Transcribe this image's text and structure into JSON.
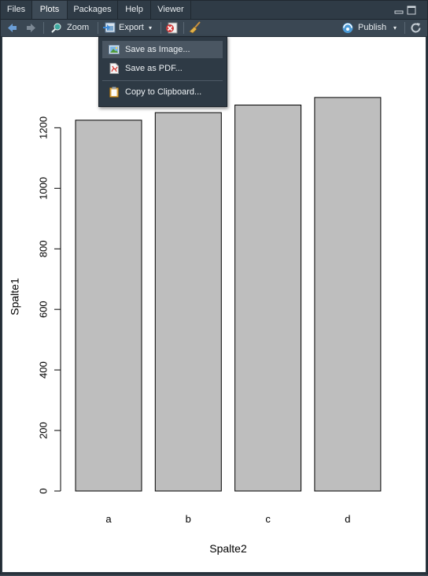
{
  "tabs": [
    {
      "label": "Files",
      "active": false
    },
    {
      "label": "Plots",
      "active": true
    },
    {
      "label": "Packages",
      "active": false
    },
    {
      "label": "Help",
      "active": false
    },
    {
      "label": "Viewer",
      "active": false
    }
  ],
  "toolbar": {
    "zoom_label": "Zoom",
    "export_label": "Export",
    "publish_label": "Publish"
  },
  "export_menu": {
    "items": [
      {
        "label": "Save as Image...",
        "icon": "image-icon"
      },
      {
        "label": "Save as PDF...",
        "icon": "pdf-icon"
      },
      {
        "label": "Copy to Clipboard...",
        "icon": "clipboard-icon"
      }
    ]
  },
  "chart_data": {
    "type": "bar",
    "categories": [
      "a",
      "b",
      "c",
      "d"
    ],
    "values": [
      1225,
      1250,
      1275,
      1300
    ],
    "xlabel": "Spalte2",
    "ylabel": "Spalte1",
    "ylim": [
      0,
      1300
    ],
    "yticks": [
      0,
      200,
      400,
      600,
      800,
      1000,
      1200
    ],
    "bar_color": "#bebebe",
    "grid": false
  }
}
